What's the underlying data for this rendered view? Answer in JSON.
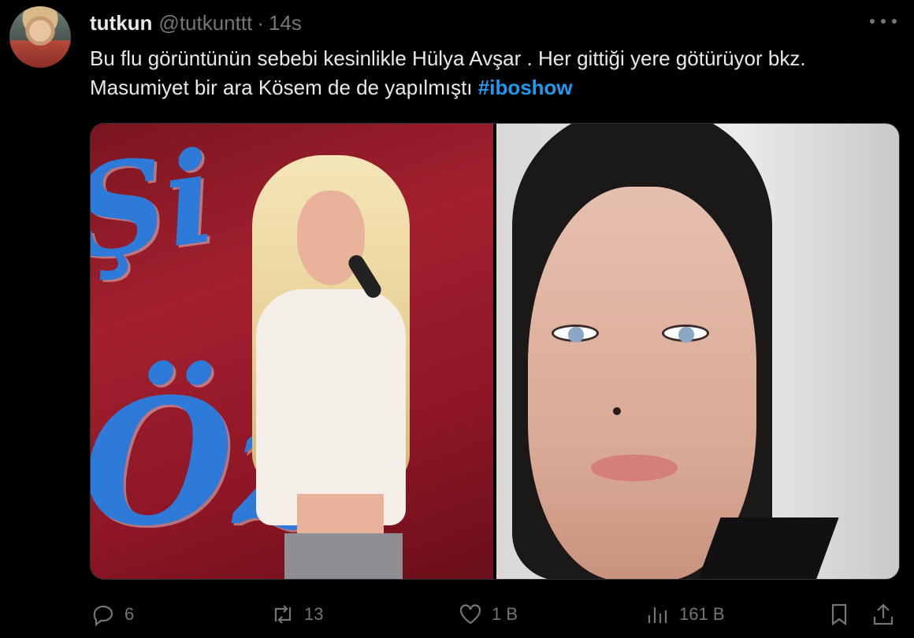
{
  "author": {
    "name": "tutkun",
    "handle": "@tutkunttt",
    "separator": "·",
    "time": "14s"
  },
  "tweet": {
    "text": "Bu flu görüntünün sebebi kesinlikle Hülya Avşar . Her gittiği yere götürüyor bkz. Masumiyet  bir ara Kösem de de yapılmıştı",
    "hashtag": "#iboshow"
  },
  "media": {
    "left_image_text": "Şi Öz",
    "count": 2
  },
  "actions": {
    "replies": "6",
    "retweets": "13",
    "likes": "1 B",
    "views": "161 B"
  },
  "icons": [
    "more-icon",
    "reply-icon",
    "retweet-icon",
    "like-icon",
    "views-icon",
    "bookmark-icon",
    "share-icon"
  ],
  "colors": {
    "background": "#000000",
    "text": "#e7e9ea",
    "muted": "#71767b",
    "accent": "#1d9bf0"
  }
}
